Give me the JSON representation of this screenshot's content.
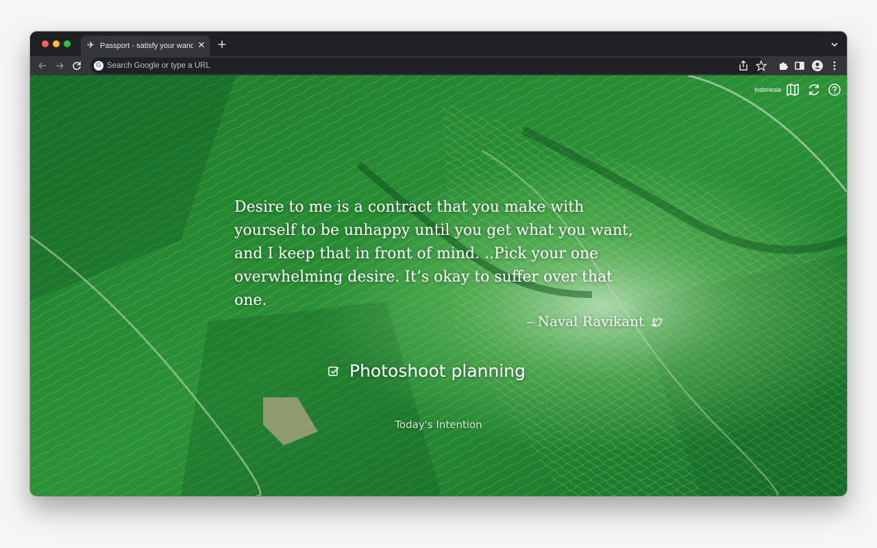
{
  "browser": {
    "tab_title": "Passport - satisfy your wander",
    "tab_favicon": "airplane-icon",
    "tab_close": "close-icon",
    "new_tab": "plus-icon",
    "omnibox_placeholder": "Search Google or type a URL",
    "toolbar_icons": [
      "share-icon",
      "bookmark-star-icon",
      "extensions-icon",
      "side-panel-icon",
      "profile-icon",
      "more-menu-icon"
    ]
  },
  "page": {
    "location": "Indonesia",
    "top_icons": [
      "map-icon",
      "refresh-icon",
      "help-icon"
    ],
    "quote": "Desire to me is a contract that you make with yourself to be unhappy until you get what you want, and I keep that in front of mind. ..Pick your one overwhelming desire. It’s okay to suffer over that one.",
    "author": "– Naval Ravikant",
    "intention": "Photoshoot planning",
    "intention_label": "Today's Intention"
  },
  "colors": {
    "chrome_dark": "#202124",
    "chrome_toolbar": "#35363a",
    "text_light": "#e8eaed",
    "foliage_dark": "#0f5a22",
    "foliage_mid": "#2f9a3a",
    "foliage_light": "#6fcf5a"
  }
}
